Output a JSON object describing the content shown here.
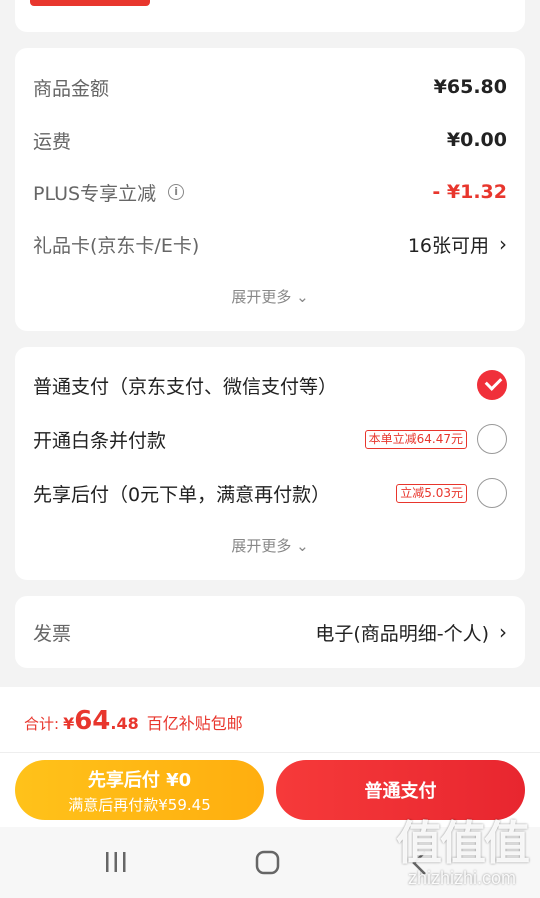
{
  "price_card": {
    "goods_amount_label": "商品金额",
    "goods_amount_value": "¥65.80",
    "freight_label": "运费",
    "freight_value": "¥0.00",
    "plus_label": "PLUS专享立减",
    "plus_value": "- ¥1.32",
    "giftcard_label": "礼品卡(京东卡/E卡)",
    "giftcard_value": "16张可用",
    "expand_label": "展开更多"
  },
  "payment_card": {
    "options": [
      {
        "label": "普通支付（京东支付、微信支付等）",
        "tag": "",
        "checked": true
      },
      {
        "label": "开通白条并付款",
        "tag": "本单立减64.47元",
        "checked": false
      },
      {
        "label": "先享后付（0元下单，满意再付款）",
        "tag": "立减5.03元",
        "checked": false
      }
    ],
    "expand_label": "展开更多"
  },
  "invoice": {
    "label": "发票",
    "value": "电子(商品明细-个人)"
  },
  "total": {
    "label": "合计:",
    "currency": "¥",
    "integer": "64",
    "decimal": ".48",
    "subsidy": "百亿补贴包邮"
  },
  "buttons": {
    "pay_later_title": "先享后付 ¥0",
    "pay_later_sub": "满意后再付款¥59.45",
    "normal_pay": "普通支付"
  },
  "watermark": {
    "title": "值值值",
    "url": "zhizhizhi.com"
  },
  "colors": {
    "accent": "#e8362d",
    "pay_later": "#ffb716",
    "background": "#f3f3f3"
  },
  "icons": [
    "info-icon",
    "chevron-right-icon",
    "chevron-down-icon",
    "check-circle-icon",
    "radio-empty-icon",
    "recent-apps-icon",
    "home-icon",
    "back-icon"
  ]
}
